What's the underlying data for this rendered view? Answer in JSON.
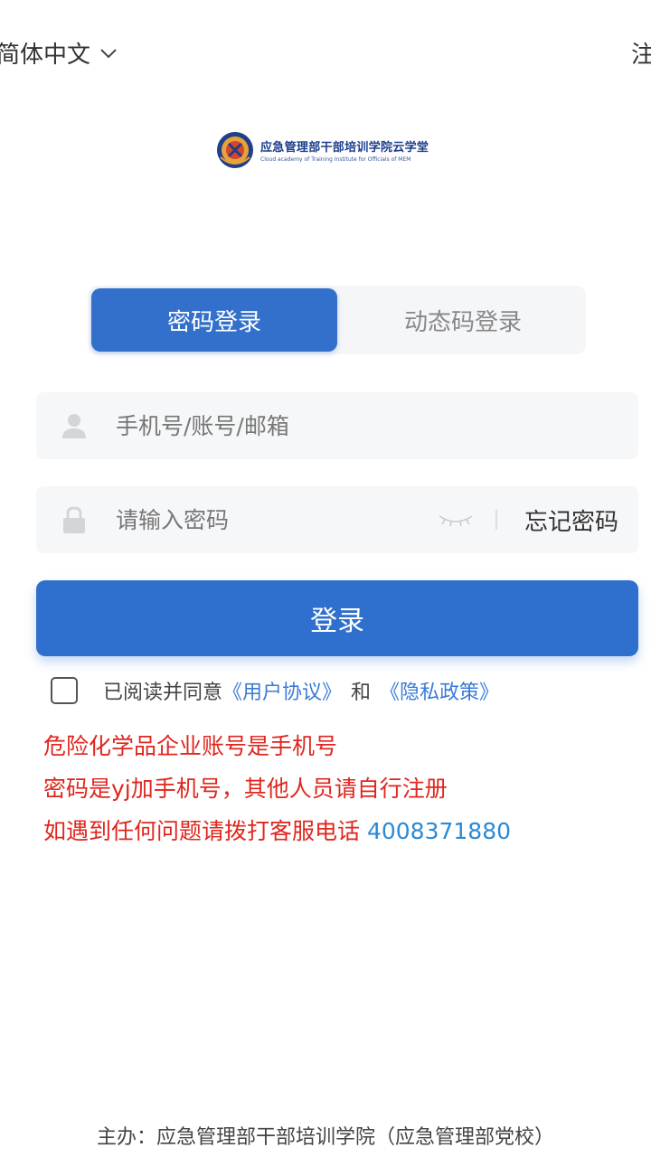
{
  "header": {
    "language_label": "简体中文",
    "register_label": "注"
  },
  "logo": {
    "title_cn": "应急管理部干部培训学院云学堂",
    "title_en": "Cloud academy of Training Institute for Officials of MEM"
  },
  "tabs": [
    {
      "label": "密码登录",
      "active": true
    },
    {
      "label": "动态码登录",
      "active": false
    }
  ],
  "form": {
    "account_placeholder": "手机号/账号/邮箱",
    "password_placeholder": "请输入密码",
    "forgot_label": "忘记密码",
    "login_label": "登录"
  },
  "agreement": {
    "prefix": "已阅读并同意",
    "user_agreement": "《用户协议》",
    "and": "和",
    "privacy_policy": "《隐私政策》"
  },
  "notice": {
    "line1": "危险化学品企业账号是手机号",
    "line2": "密码是yj加手机号，其他人员请自行注册",
    "line3_prefix": "如遇到任何问题请拨打客服电话",
    "phone": "4008371880"
  },
  "footer": {
    "text": "主办：应急管理部干部培训学院（应急管理部党校）"
  },
  "colors": {
    "primary": "#2f6fcd",
    "notice_red": "#e0261e",
    "link_blue": "#3a7bd5"
  }
}
